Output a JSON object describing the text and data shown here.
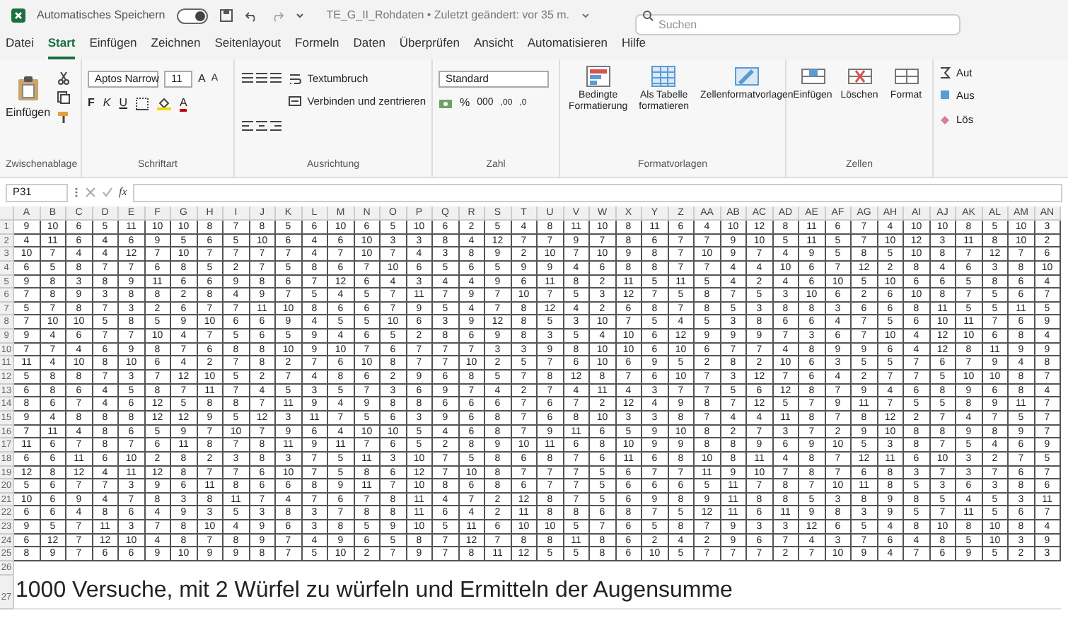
{
  "title_bar": {
    "autosave_label": "Automatisches Speichern",
    "autosave_on": true,
    "document_title": "TE_G_II_Rohdaten • Zuletzt geändert: vor 35 m.",
    "search_placeholder": "Suchen"
  },
  "menu_tabs": [
    {
      "label": "Datei",
      "selected": false
    },
    {
      "label": "Start",
      "selected": true
    },
    {
      "label": "Einfügen",
      "selected": false
    },
    {
      "label": "Zeichnen",
      "selected": false
    },
    {
      "label": "Seitenlayout",
      "selected": false
    },
    {
      "label": "Formeln",
      "selected": false
    },
    {
      "label": "Daten",
      "selected": false
    },
    {
      "label": "Überprüfen",
      "selected": false
    },
    {
      "label": "Ansicht",
      "selected": false
    },
    {
      "label": "Automatisieren",
      "selected": false
    },
    {
      "label": "Hilfe",
      "selected": false
    }
  ],
  "ribbon": {
    "clipboard": {
      "paste": "Einfügen",
      "label": "Zwischenablage"
    },
    "font": {
      "name": "Aptos Narrow",
      "size": "11",
      "grow": "A",
      "shrink": "A",
      "bold": "F",
      "italic": "K",
      "underline": "U",
      "color_letter": "A",
      "label": "Schriftart"
    },
    "alignment": {
      "wrap": "Textumbruch",
      "merge": "Verbinden und zentrieren",
      "label": "Ausrichtung"
    },
    "number": {
      "format": "Standard",
      "percent": "%",
      "thousands": "000",
      "more_decimals": ",00",
      "fewer_decimals": ",0",
      "label": "Zahl"
    },
    "styles": {
      "buttons": [
        "Bedingte\nFormatierung",
        "Als Tabelle\nformatieren",
        "Zellenformatvorlagen"
      ],
      "label": "Formatvorlagen"
    },
    "cells": {
      "buttons": [
        "Einfügen",
        "Löschen",
        "Format"
      ],
      "label": "Zellen"
    },
    "editing": [
      "Aut",
      "Aus",
      "Lös"
    ]
  },
  "formula_bar": {
    "name_box": "P31",
    "fx": "fx"
  },
  "sheet": {
    "columns": [
      "A",
      "B",
      "C",
      "D",
      "E",
      "F",
      "G",
      "H",
      "I",
      "J",
      "K",
      "L",
      "M",
      "N",
      "O",
      "P",
      "Q",
      "R",
      "S",
      "T",
      "U",
      "V",
      "W",
      "X",
      "Y",
      "Z",
      "AA",
      "AB",
      "AC",
      "AD",
      "AE",
      "AF",
      "AG",
      "AH",
      "AI",
      "AJ",
      "AK",
      "AL",
      "AM",
      "AN"
    ],
    "rows": [
      {
        "number": "1",
        "cells": [
          "9",
          "10",
          "6",
          "5",
          "11",
          "10",
          "10",
          "8",
          "7",
          "8",
          "5",
          "6",
          "10",
          "6",
          "5",
          "10",
          "6",
          "2",
          "5",
          "4",
          "8",
          "11",
          "10",
          "8",
          "11",
          "6",
          "4",
          "10",
          "12",
          "8",
          "11",
          "6",
          "7",
          "4",
          "10",
          "10",
          "8",
          "5",
          "10",
          "3"
        ]
      },
      {
        "number": "2",
        "cells": [
          "4",
          "11",
          "6",
          "4",
          "6",
          "9",
          "5",
          "6",
          "5",
          "10",
          "6",
          "4",
          "6",
          "10",
          "3",
          "3",
          "8",
          "4",
          "12",
          "7",
          "7",
          "9",
          "7",
          "8",
          "6",
          "7",
          "7",
          "9",
          "10",
          "5",
          "11",
          "5",
          "7",
          "10",
          "12",
          "3",
          "11",
          "8",
          "10",
          "2"
        ]
      },
      {
        "number": "3",
        "cells": [
          "10",
          "7",
          "4",
          "4",
          "12",
          "7",
          "10",
          "7",
          "7",
          "7",
          "7",
          "4",
          "7",
          "10",
          "7",
          "4",
          "3",
          "8",
          "9",
          "2",
          "10",
          "7",
          "10",
          "9",
          "8",
          "7",
          "10",
          "9",
          "7",
          "4",
          "9",
          "5",
          "8",
          "5",
          "10",
          "8",
          "7",
          "12",
          "7",
          "6"
        ]
      },
      {
        "number": "4",
        "cells": [
          "6",
          "5",
          "8",
          "7",
          "7",
          "6",
          "8",
          "5",
          "2",
          "7",
          "5",
          "8",
          "6",
          "7",
          "10",
          "6",
          "5",
          "6",
          "5",
          "9",
          "9",
          "4",
          "6",
          "8",
          "8",
          "7",
          "7",
          "4",
          "4",
          "10",
          "6",
          "7",
          "12",
          "2",
          "8",
          "4",
          "6",
          "3",
          "8",
          "10"
        ]
      },
      {
        "number": "5",
        "cells": [
          "9",
          "8",
          "3",
          "8",
          "9",
          "11",
          "6",
          "6",
          "9",
          "8",
          "6",
          "7",
          "12",
          "6",
          "4",
          "3",
          "4",
          "4",
          "9",
          "6",
          "11",
          "8",
          "2",
          "11",
          "5",
          "11",
          "5",
          "4",
          "2",
          "4",
          "6",
          "10",
          "5",
          "10",
          "6",
          "6",
          "5",
          "8",
          "6",
          "4"
        ]
      },
      {
        "number": "6",
        "cells": [
          "7",
          "8",
          "9",
          "3",
          "8",
          "8",
          "2",
          "8",
          "4",
          "9",
          "7",
          "5",
          "4",
          "5",
          "7",
          "11",
          "7",
          "9",
          "7",
          "10",
          "7",
          "5",
          "3",
          "12",
          "7",
          "5",
          "8",
          "7",
          "5",
          "3",
          "10",
          "6",
          "2",
          "6",
          "10",
          "8",
          "7",
          "5",
          "6",
          "7"
        ]
      },
      {
        "number": "7",
        "cells": [
          "5",
          "7",
          "8",
          "7",
          "3",
          "2",
          "6",
          "7",
          "7",
          "11",
          "10",
          "8",
          "6",
          "6",
          "7",
          "9",
          "5",
          "4",
          "7",
          "8",
          "12",
          "4",
          "2",
          "6",
          "8",
          "7",
          "8",
          "5",
          "3",
          "8",
          "8",
          "3",
          "6",
          "6",
          "8",
          "11",
          "5",
          "5",
          "11",
          "5"
        ]
      },
      {
        "number": "8",
        "cells": [
          "7",
          "10",
          "10",
          "5",
          "8",
          "5",
          "9",
          "10",
          "6",
          "6",
          "9",
          "4",
          "5",
          "5",
          "10",
          "6",
          "3",
          "9",
          "12",
          "8",
          "5",
          "3",
          "10",
          "7",
          "5",
          "4",
          "5",
          "3",
          "8",
          "6",
          "6",
          "4",
          "7",
          "5",
          "6",
          "10",
          "11",
          "7",
          "6",
          "9"
        ]
      },
      {
        "number": "9",
        "cells": [
          "9",
          "4",
          "6",
          "7",
          "7",
          "10",
          "4",
          "7",
          "5",
          "6",
          "5",
          "9",
          "4",
          "6",
          "5",
          "2",
          "8",
          "6",
          "9",
          "8",
          "3",
          "5",
          "4",
          "10",
          "6",
          "12",
          "9",
          "9",
          "9",
          "7",
          "3",
          "6",
          "7",
          "10",
          "4",
          "12",
          "10",
          "6",
          "8",
          "4"
        ]
      },
      {
        "number": "10",
        "cells": [
          "7",
          "7",
          "4",
          "6",
          "9",
          "8",
          "7",
          "6",
          "8",
          "8",
          "10",
          "9",
          "10",
          "7",
          "6",
          "7",
          "7",
          "7",
          "3",
          "3",
          "9",
          "8",
          "10",
          "10",
          "6",
          "10",
          "6",
          "7",
          "7",
          "4",
          "8",
          "9",
          "9",
          "6",
          "4",
          "12",
          "8",
          "11",
          "9",
          "9"
        ]
      },
      {
        "number": "11",
        "cells": [
          "11",
          "4",
          "10",
          "8",
          "10",
          "6",
          "4",
          "2",
          "7",
          "8",
          "2",
          "7",
          "6",
          "10",
          "8",
          "7",
          "7",
          "10",
          "2",
          "5",
          "7",
          "6",
          "10",
          "6",
          "9",
          "5",
          "2",
          "8",
          "2",
          "10",
          "6",
          "3",
          "5",
          "5",
          "7",
          "6",
          "7",
          "9",
          "4",
          "8"
        ]
      },
      {
        "number": "12",
        "cells": [
          "5",
          "8",
          "8",
          "7",
          "3",
          "7",
          "12",
          "10",
          "5",
          "2",
          "7",
          "4",
          "8",
          "6",
          "2",
          "9",
          "6",
          "8",
          "5",
          "7",
          "8",
          "12",
          "8",
          "7",
          "6",
          "10",
          "7",
          "3",
          "12",
          "7",
          "6",
          "4",
          "2",
          "7",
          "7",
          "5",
          "10",
          "10",
          "8",
          "7"
        ]
      },
      {
        "number": "13",
        "cells": [
          "6",
          "8",
          "6",
          "4",
          "5",
          "8",
          "7",
          "11",
          "7",
          "4",
          "5",
          "3",
          "5",
          "7",
          "3",
          "6",
          "9",
          "7",
          "4",
          "2",
          "7",
          "4",
          "11",
          "4",
          "3",
          "7",
          "7",
          "5",
          "6",
          "12",
          "8",
          "7",
          "9",
          "4",
          "6",
          "8",
          "9",
          "6",
          "8",
          "4"
        ]
      },
      {
        "number": "14",
        "cells": [
          "8",
          "6",
          "7",
          "4",
          "6",
          "12",
          "5",
          "8",
          "8",
          "7",
          "11",
          "9",
          "4",
          "9",
          "8",
          "8",
          "6",
          "6",
          "6",
          "7",
          "6",
          "7",
          "2",
          "12",
          "4",
          "9",
          "8",
          "7",
          "12",
          "5",
          "7",
          "9",
          "11",
          "7",
          "5",
          "5",
          "8",
          "9",
          "11",
          "7"
        ]
      },
      {
        "number": "15",
        "cells": [
          "9",
          "4",
          "8",
          "8",
          "8",
          "12",
          "12",
          "9",
          "5",
          "12",
          "3",
          "11",
          "7",
          "5",
          "6",
          "3",
          "9",
          "6",
          "8",
          "7",
          "6",
          "8",
          "10",
          "3",
          "3",
          "8",
          "7",
          "4",
          "4",
          "11",
          "8",
          "7",
          "8",
          "12",
          "2",
          "7",
          "4",
          "7",
          "5",
          "7"
        ]
      },
      {
        "number": "16",
        "cells": [
          "7",
          "11",
          "4",
          "8",
          "6",
          "5",
          "9",
          "7",
          "10",
          "7",
          "9",
          "6",
          "4",
          "10",
          "10",
          "5",
          "4",
          "6",
          "8",
          "7",
          "9",
          "11",
          "6",
          "5",
          "9",
          "10",
          "8",
          "2",
          "7",
          "3",
          "7",
          "2",
          "9",
          "10",
          "8",
          "8",
          "9",
          "8",
          "9",
          "7"
        ]
      },
      {
        "number": "17",
        "cells": [
          "11",
          "6",
          "7",
          "8",
          "7",
          "6",
          "11",
          "8",
          "7",
          "8",
          "11",
          "9",
          "11",
          "7",
          "6",
          "5",
          "2",
          "8",
          "9",
          "10",
          "11",
          "6",
          "8",
          "10",
          "9",
          "9",
          "8",
          "8",
          "9",
          "6",
          "9",
          "10",
          "5",
          "3",
          "8",
          "7",
          "5",
          "4",
          "6",
          "9"
        ]
      },
      {
        "number": "18",
        "cells": [
          "6",
          "6",
          "11",
          "6",
          "10",
          "2",
          "8",
          "2",
          "3",
          "8",
          "3",
          "7",
          "5",
          "11",
          "3",
          "10",
          "7",
          "5",
          "8",
          "6",
          "8",
          "7",
          "6",
          "11",
          "6",
          "8",
          "10",
          "8",
          "11",
          "4",
          "8",
          "7",
          "12",
          "11",
          "6",
          "10",
          "3",
          "2",
          "7",
          "5"
        ]
      },
      {
        "number": "19",
        "cells": [
          "12",
          "8",
          "12",
          "4",
          "11",
          "12",
          "8",
          "7",
          "7",
          "6",
          "10",
          "7",
          "5",
          "8",
          "6",
          "12",
          "7",
          "10",
          "8",
          "7",
          "7",
          "7",
          "5",
          "6",
          "7",
          "7",
          "11",
          "9",
          "10",
          "7",
          "8",
          "7",
          "6",
          "8",
          "3",
          "7",
          "3",
          "7",
          "6",
          "7"
        ]
      },
      {
        "number": "20",
        "cells": [
          "5",
          "6",
          "7",
          "7",
          "3",
          "9",
          "6",
          "11",
          "8",
          "6",
          "6",
          "8",
          "9",
          "11",
          "7",
          "10",
          "8",
          "6",
          "8",
          "6",
          "7",
          "7",
          "5",
          "6",
          "6",
          "6",
          "5",
          "11",
          "7",
          "8",
          "7",
          "10",
          "11",
          "8",
          "5",
          "3",
          "6",
          "3",
          "8",
          "6"
        ]
      },
      {
        "number": "21",
        "cells": [
          "10",
          "6",
          "9",
          "4",
          "7",
          "8",
          "3",
          "8",
          "11",
          "7",
          "4",
          "7",
          "6",
          "7",
          "8",
          "11",
          "4",
          "7",
          "2",
          "12",
          "8",
          "7",
          "5",
          "6",
          "9",
          "8",
          "9",
          "11",
          "8",
          "8",
          "5",
          "3",
          "8",
          "9",
          "8",
          "5",
          "4",
          "5",
          "3",
          "11"
        ]
      },
      {
        "number": "22",
        "cells": [
          "6",
          "6",
          "4",
          "8",
          "6",
          "4",
          "9",
          "3",
          "5",
          "3",
          "8",
          "3",
          "7",
          "8",
          "8",
          "11",
          "6",
          "4",
          "2",
          "11",
          "8",
          "8",
          "6",
          "8",
          "7",
          "5",
          "12",
          "11",
          "6",
          "11",
          "9",
          "8",
          "3",
          "9",
          "5",
          "7",
          "11",
          "5",
          "6",
          "7"
        ]
      },
      {
        "number": "23",
        "cells": [
          "9",
          "5",
          "7",
          "11",
          "3",
          "7",
          "8",
          "10",
          "4",
          "9",
          "6",
          "3",
          "8",
          "5",
          "9",
          "10",
          "5",
          "11",
          "6",
          "10",
          "10",
          "5",
          "7",
          "6",
          "5",
          "8",
          "7",
          "9",
          "3",
          "3",
          "12",
          "6",
          "5",
          "4",
          "8",
          "10",
          "8",
          "10",
          "8",
          "4"
        ]
      },
      {
        "number": "24",
        "cells": [
          "6",
          "12",
          "7",
          "12",
          "10",
          "4",
          "8",
          "7",
          "8",
          "9",
          "7",
          "4",
          "9",
          "6",
          "5",
          "8",
          "7",
          "12",
          "7",
          "8",
          "8",
          "11",
          "8",
          "6",
          "2",
          "4",
          "2",
          "9",
          "6",
          "7",
          "4",
          "3",
          "7",
          "6",
          "4",
          "8",
          "5",
          "10",
          "3",
          "9"
        ]
      },
      {
        "number": "25",
        "cells": [
          "8",
          "9",
          "7",
          "6",
          "6",
          "9",
          "10",
          "9",
          "9",
          "8",
          "7",
          "5",
          "10",
          "2",
          "7",
          "9",
          "7",
          "8",
          "11",
          "12",
          "5",
          "5",
          "8",
          "6",
          "10",
          "5",
          "7",
          "7",
          "7",
          "2",
          "7",
          "10",
          "9",
          "4",
          "7",
          "6",
          "9",
          "5",
          "2",
          "3"
        ]
      },
      {
        "number": "26"
      },
      {
        "number": "27",
        "note": "1000 Versuche, mit 2 Würfel zu würfeln und Ermitteln der Augensumme"
      }
    ]
  }
}
